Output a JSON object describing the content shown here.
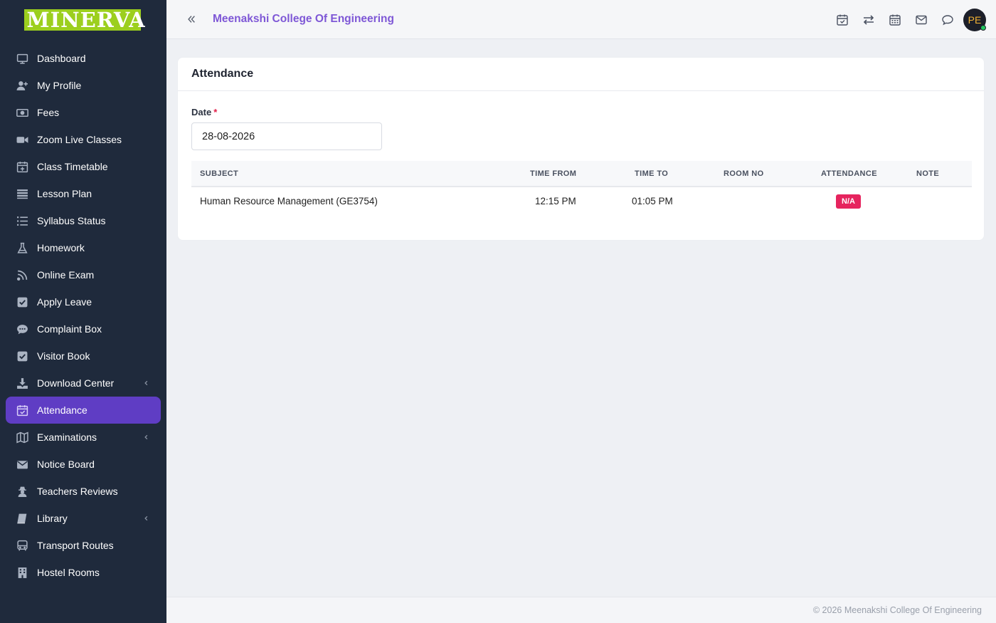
{
  "sidebar": {
    "logo": "MINERVA",
    "items": [
      {
        "label": "Dashboard",
        "icon": "monitor-icon"
      },
      {
        "label": "My Profile",
        "icon": "user-plus-icon"
      },
      {
        "label": "Fees",
        "icon": "money-icon"
      },
      {
        "label": "Zoom Live Classes",
        "icon": "video-icon"
      },
      {
        "label": "Class Timetable",
        "icon": "calendar-plus-icon"
      },
      {
        "label": "Lesson Plan",
        "icon": "list-icon"
      },
      {
        "label": "Syllabus Status",
        "icon": "list-ordered-icon"
      },
      {
        "label": "Homework",
        "icon": "flask-icon"
      },
      {
        "label": "Online Exam",
        "icon": "rss-icon"
      },
      {
        "label": "Apply Leave",
        "icon": "check-square-icon"
      },
      {
        "label": "Complaint Box",
        "icon": "comment-icon"
      },
      {
        "label": "Visitor Book",
        "icon": "check-square-icon"
      },
      {
        "label": "Download Center",
        "icon": "download-icon"
      },
      {
        "label": "Attendance",
        "icon": "calendar-check-icon"
      },
      {
        "label": "Examinations",
        "icon": "map-icon"
      },
      {
        "label": "Notice Board",
        "icon": "envelope-icon"
      },
      {
        "label": "Teachers Reviews",
        "icon": "user-secret-icon"
      },
      {
        "label": "Library",
        "icon": "book-icon"
      },
      {
        "label": "Transport Routes",
        "icon": "bus-icon"
      },
      {
        "label": "Hostel Rooms",
        "icon": "building-icon"
      }
    ],
    "active": "Attendance"
  },
  "header": {
    "title": "Meenakshi College Of Engineering",
    "icons": [
      "calendar-check-icon",
      "exchange-icon",
      "calendar-icon",
      "mail-icon",
      "chat-icon"
    ],
    "avatar_initials": "PE"
  },
  "card": {
    "title": "Attendance",
    "date_label": "Date",
    "required_mark": "*",
    "date_value": "28-08-2026"
  },
  "table": {
    "columns": [
      "SUBJECT",
      "TIME FROM",
      "TIME TO",
      "ROOM NO",
      "ATTENDANCE",
      "NOTE"
    ],
    "rows": [
      {
        "subject": "Human Resource Management (GE3754)",
        "time_from": "12:15 PM",
        "time_to": "01:05 PM",
        "room_no": "",
        "attendance": "N/A",
        "note": ""
      }
    ]
  },
  "footer": {
    "text": "© 2026 Meenakshi College Of Engineering"
  },
  "colors": {
    "sidebar_bg": "#1f2a3c",
    "active_item": "#5f3dc4",
    "brand_text": "#7e57d6",
    "logo_bg": "#9ccf1e",
    "badge": "#e6245e"
  }
}
